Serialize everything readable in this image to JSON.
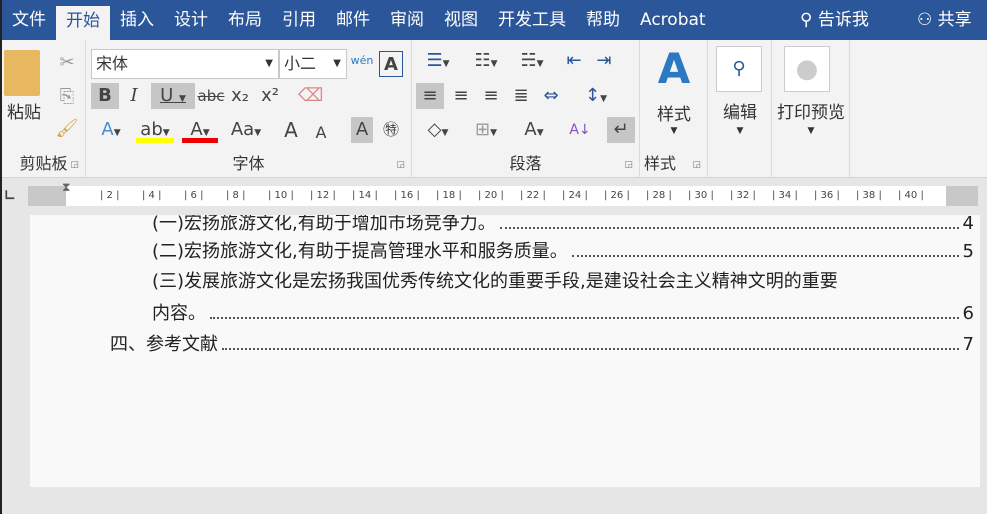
{
  "tabs": [
    "文件",
    "开始",
    "插入",
    "设计",
    "布局",
    "引用",
    "邮件",
    "审阅",
    "视图",
    "开发工具",
    "帮助",
    "Acrobat"
  ],
  "tell_me": "告诉我",
  "share": "共享",
  "clipboard": {
    "paste": "粘贴",
    "label": "剪贴板"
  },
  "font": {
    "name": "宋体",
    "size": "小二",
    "label": "字体",
    "bold": "B",
    "italic": "I",
    "underline": "U",
    "strike": "abc",
    "sub": "x₂",
    "sup": "x²",
    "change_case": "Aa",
    "grow": "A",
    "shrink": "A",
    "shading": "A",
    "phonetic": "wén"
  },
  "paragraph": {
    "label": "段落"
  },
  "styles": {
    "button": "样式",
    "label": "样式"
  },
  "editing": {
    "button": "编辑"
  },
  "print_preview": {
    "button": "打印预览"
  },
  "ruler": {
    "ticks": [
      "2",
      "4",
      "6",
      "8",
      "10",
      "12",
      "14",
      "16",
      "18",
      "20",
      "22",
      "24",
      "26",
      "28",
      "30",
      "32",
      "34",
      "36",
      "38",
      "40"
    ]
  },
  "toc": [
    {
      "text": "(一)宏扬旅游文化,有助于增加市场竞争力。",
      "page": "4"
    },
    {
      "text": "(二)宏扬旅游文化,有助于提高管理水平和服务质量。",
      "page": "5"
    },
    {
      "text": "(三)发展旅游文化是宏扬我国优秀传统文化的重要手段,是建设社会主义精神文明的重要",
      "page": ""
    },
    {
      "text": "内容。",
      "page": "6"
    },
    {
      "text": "四、参考文献",
      "page": "7"
    }
  ]
}
